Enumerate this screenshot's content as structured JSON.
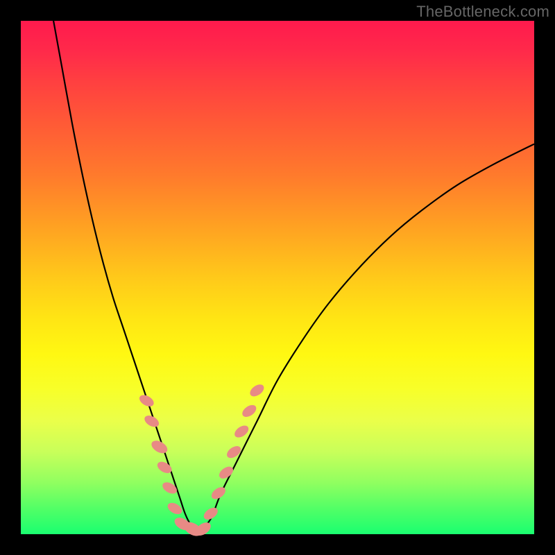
{
  "watermark": "TheBottleneck.com",
  "colors": {
    "frame": "#000000",
    "gradient_top": "#ff1a4d",
    "gradient_bottom": "#1aff70",
    "curve": "#000000",
    "markers": "#e88a85"
  },
  "chart_data": {
    "type": "line",
    "title": "",
    "xlabel": "",
    "ylabel": "",
    "xlim": [
      0,
      100
    ],
    "ylim": [
      0,
      100
    ],
    "grid": false,
    "legend": false,
    "series": [
      {
        "name": "bottleneck-curve",
        "x": [
          6,
          8,
          10,
          12,
          14,
          16,
          18,
          20,
          22,
          24,
          26,
          28,
          29,
          30,
          31,
          32,
          33,
          34,
          35,
          37,
          39,
          42,
          46,
          50,
          55,
          60,
          66,
          72,
          78,
          85,
          92,
          100
        ],
        "y": [
          102,
          91,
          80,
          70,
          61,
          53,
          46,
          40,
          34,
          28,
          22,
          16,
          13,
          10,
          7,
          4,
          2,
          1,
          1,
          3,
          8,
          14,
          22,
          30,
          38,
          45,
          52,
          58,
          63,
          68,
          72,
          76
        ]
      }
    ],
    "markers": {
      "name": "highlighted-points",
      "shape": "capsule",
      "points": [
        {
          "x": 24.5,
          "y": 26,
          "r": 9
        },
        {
          "x": 25.5,
          "y": 22,
          "r": 9
        },
        {
          "x": 27.0,
          "y": 17,
          "r": 10
        },
        {
          "x": 28.0,
          "y": 13,
          "r": 9
        },
        {
          "x": 29.0,
          "y": 9,
          "r": 9
        },
        {
          "x": 30.0,
          "y": 5,
          "r": 9
        },
        {
          "x": 31.5,
          "y": 2,
          "r": 10
        },
        {
          "x": 33.5,
          "y": 1,
          "r": 11
        },
        {
          "x": 35.5,
          "y": 1,
          "r": 10
        },
        {
          "x": 37.0,
          "y": 4,
          "r": 9
        },
        {
          "x": 38.5,
          "y": 8,
          "r": 9
        },
        {
          "x": 40.0,
          "y": 12,
          "r": 9
        },
        {
          "x": 41.5,
          "y": 16,
          "r": 9
        },
        {
          "x": 43.0,
          "y": 20,
          "r": 9
        },
        {
          "x": 44.5,
          "y": 24,
          "r": 9
        },
        {
          "x": 46.0,
          "y": 28,
          "r": 9
        }
      ]
    }
  }
}
